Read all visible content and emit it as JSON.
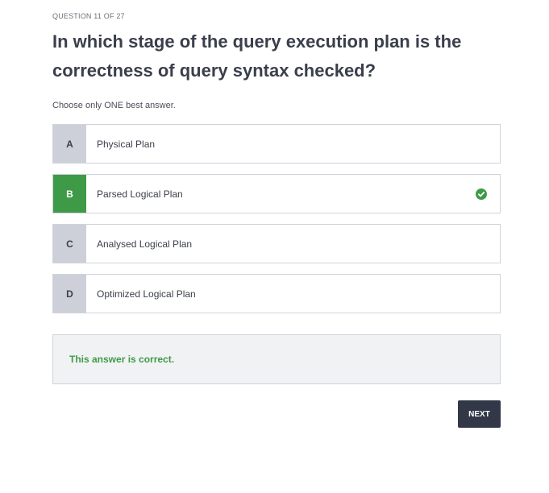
{
  "header": {
    "counter": "QUESTION 11 OF 27",
    "question": "In which stage of the query execution plan is the correctness of query syntax checked?",
    "instruction": "Choose only ONE best answer."
  },
  "options": [
    {
      "letter": "A",
      "text": "Physical Plan",
      "correct": false
    },
    {
      "letter": "B",
      "text": "Parsed Logical Plan",
      "correct": true,
      "icon": "check-circle-icon"
    },
    {
      "letter": "C",
      "text": "Analysed Logical Plan",
      "correct": false
    },
    {
      "letter": "D",
      "text": "Optimized Logical Plan",
      "correct": false
    }
  ],
  "feedback": {
    "text": "This answer is correct.",
    "color": "#3e9a47"
  },
  "actions": {
    "next_label": "NEXT"
  },
  "colors": {
    "correct": "#3e9a47",
    "button_bg": "#333848",
    "letter_bg": "#cdd0d8"
  }
}
